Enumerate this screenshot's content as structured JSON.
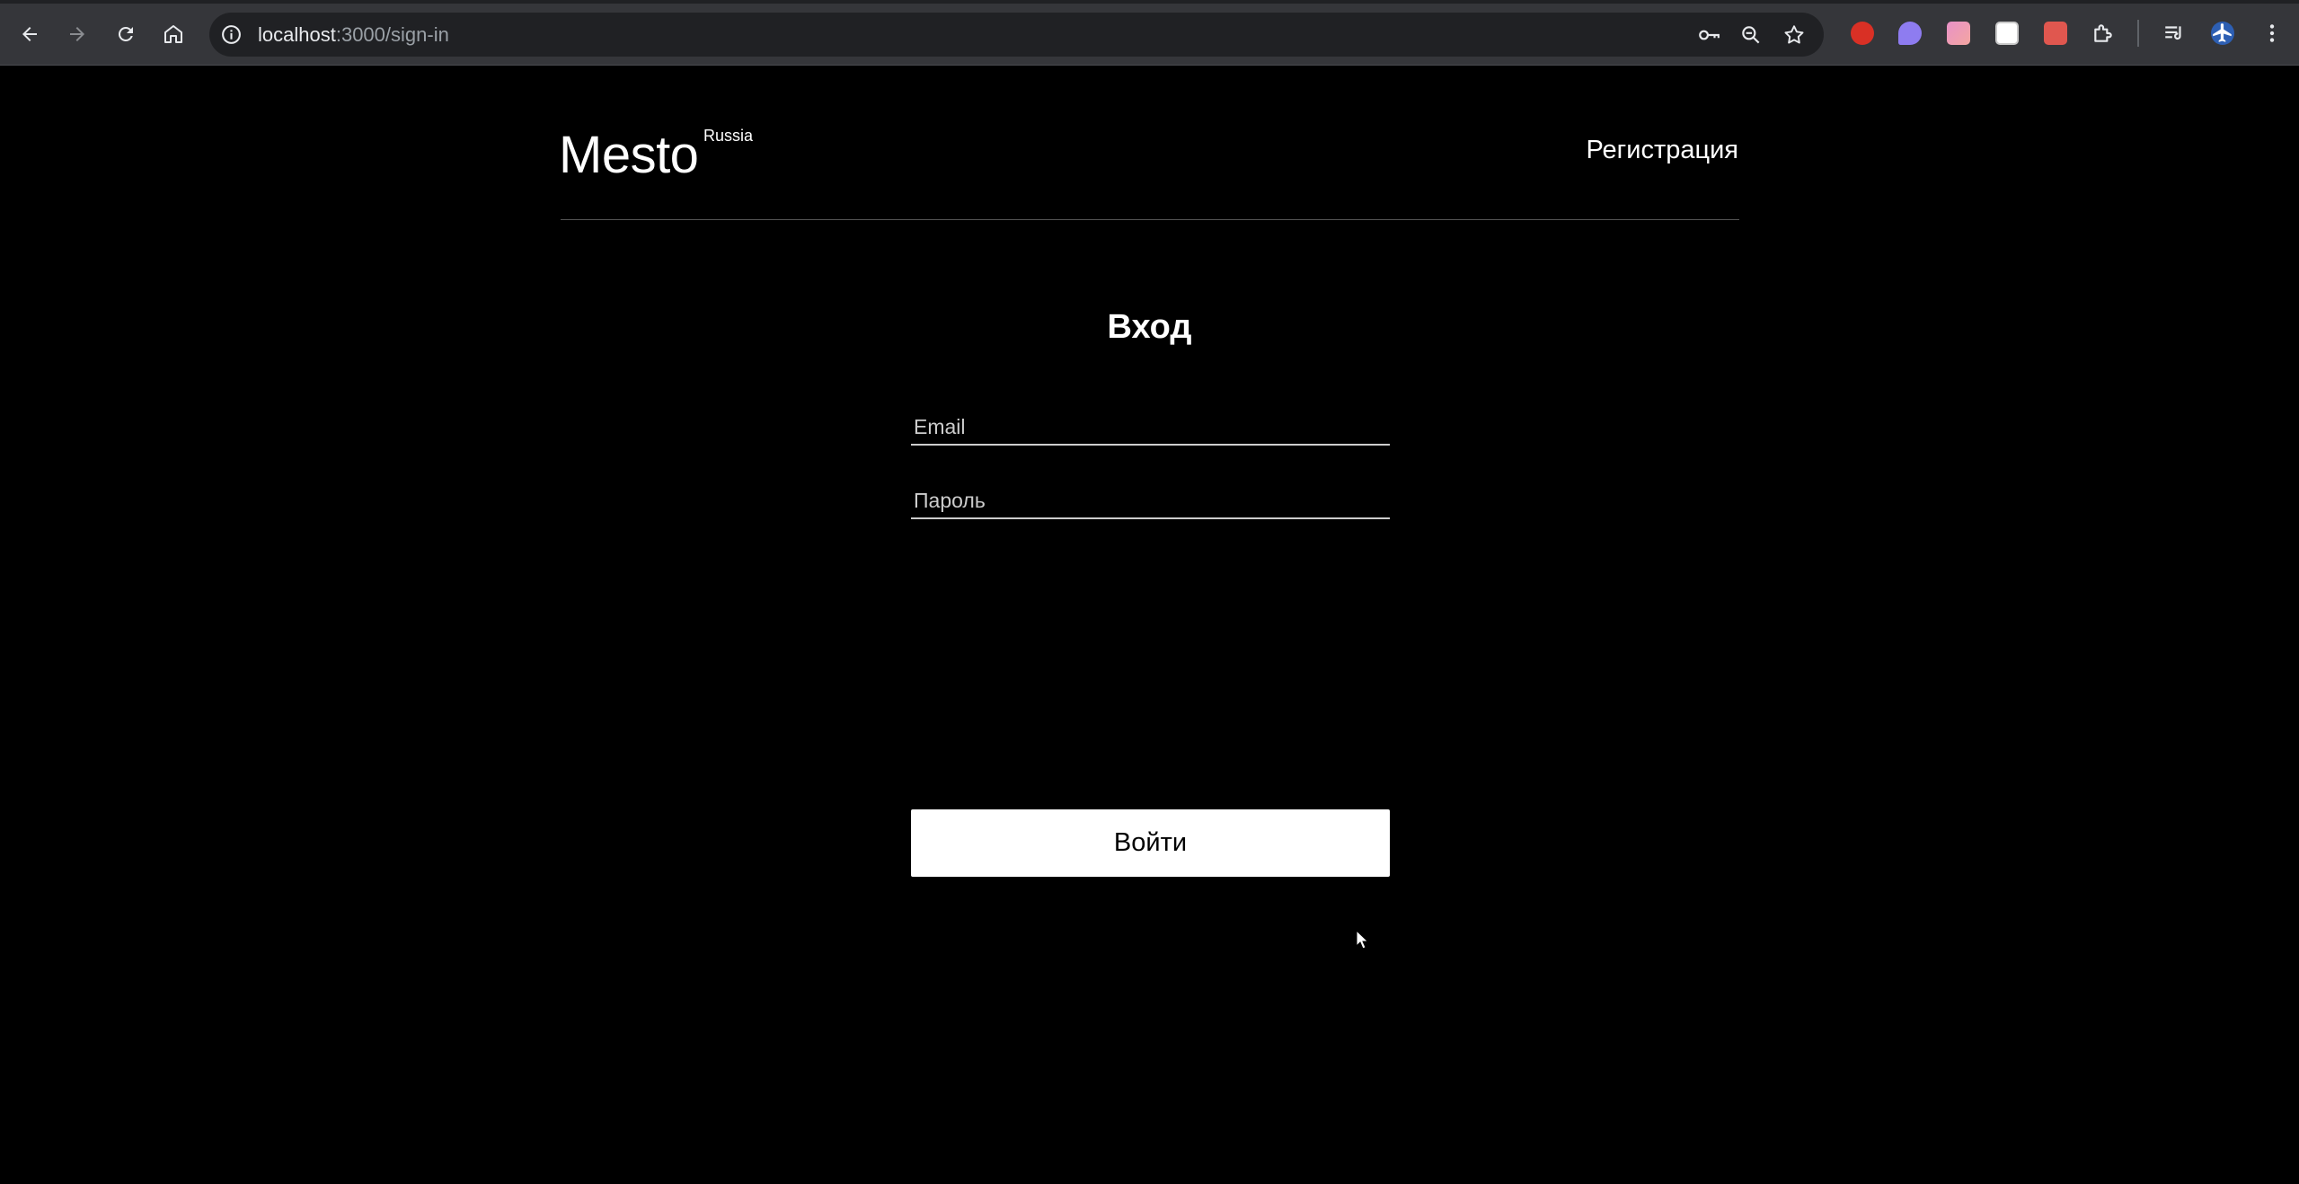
{
  "browser": {
    "url_host": "localhost",
    "url_path": ":3000/sign-in",
    "icons": {
      "back": "arrow-left-icon",
      "forward": "arrow-right-icon",
      "reload": "reload-icon",
      "home": "home-icon",
      "site_info": "info-icon",
      "passwords": "key-icon",
      "zoom": "zoom-icon",
      "bookmark": "star-icon",
      "extensions": "puzzle-icon",
      "media": "media-queue-icon",
      "menu": "more-vert-icon"
    },
    "extension_colors": [
      "#d93025",
      "#8e7cf0",
      "#e891c8",
      "#ffffff",
      "#e0574f",
      "#e8eaed"
    ]
  },
  "header": {
    "logo": "Mesto",
    "logo_sup": "Russia",
    "nav_link": "Регистрация"
  },
  "auth": {
    "title": "Вход",
    "email_placeholder": "Email",
    "password_placeholder": "Пароль",
    "submit_label": "Войти"
  },
  "colors": {
    "page_bg": "#000000",
    "text": "#ffffff",
    "divider": "#545454",
    "button_bg": "#ffffff",
    "button_text": "#000000"
  }
}
